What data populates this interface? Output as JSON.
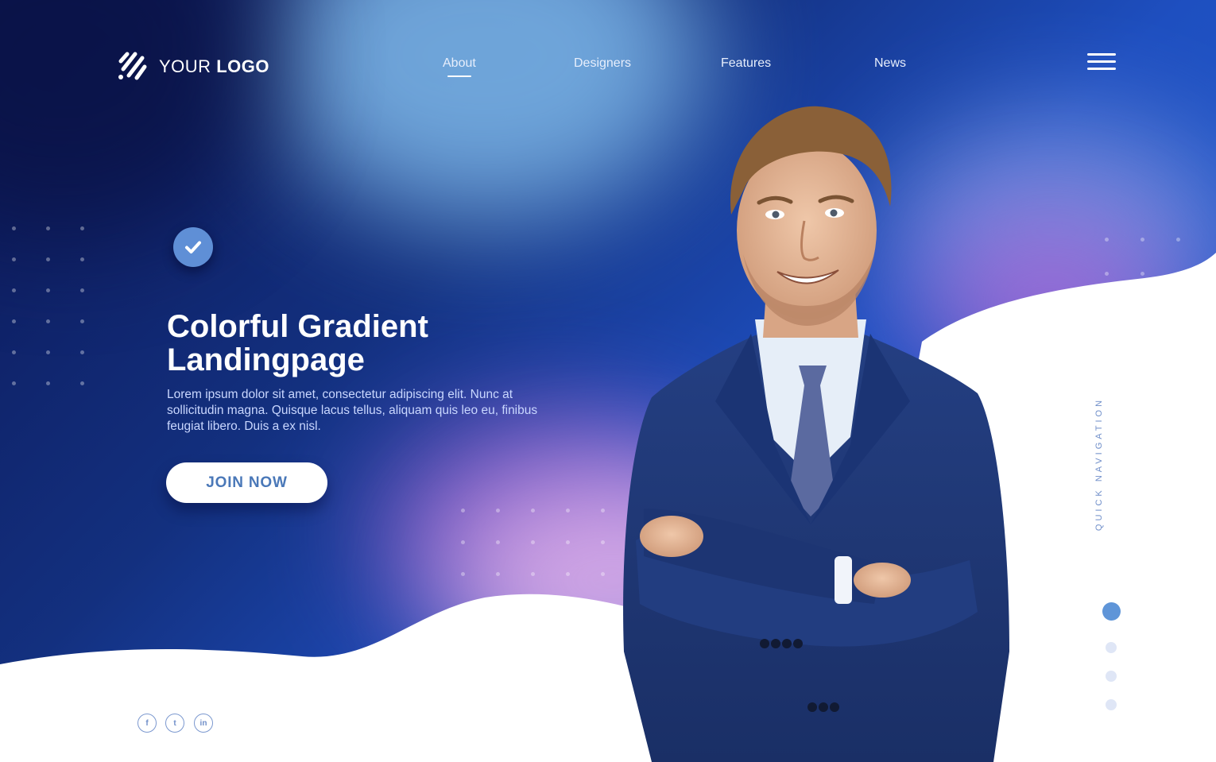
{
  "logo": {
    "text_light": "YOUR ",
    "text_bold": "LOGO"
  },
  "nav": {
    "items": [
      {
        "label": "About"
      },
      {
        "label": "Designers"
      },
      {
        "label": "Features"
      },
      {
        "label": "News"
      }
    ]
  },
  "hero": {
    "title": "Colorful Gradient Landingpage",
    "body": "Lorem ipsum dolor sit amet, consectetur adipiscing elit. Nunc at sollicitudin magna. Quisque lacus tellus, aliquam quis leo eu, finibus feugiat libero. Duis a ex nisl.",
    "cta_label": "JOIN NOW"
  },
  "quick_nav": {
    "label": "QUICK NAVIGATION",
    "dots": 4,
    "active_index": 0
  },
  "social": [
    {
      "icon": "facebook-icon",
      "glyph": "f"
    },
    {
      "icon": "twitter-icon",
      "glyph": "t"
    },
    {
      "icon": "linkedin-icon",
      "glyph": "in"
    }
  ],
  "colors": {
    "deep_navy": "#0d1a5e",
    "royal_blue": "#1d4fc1",
    "sky_blue": "#74b4ea",
    "violet": "#b35fd6",
    "pink": "#e9b3ec",
    "white": "#ffffff",
    "accent_blue": "#5f8fd6"
  }
}
